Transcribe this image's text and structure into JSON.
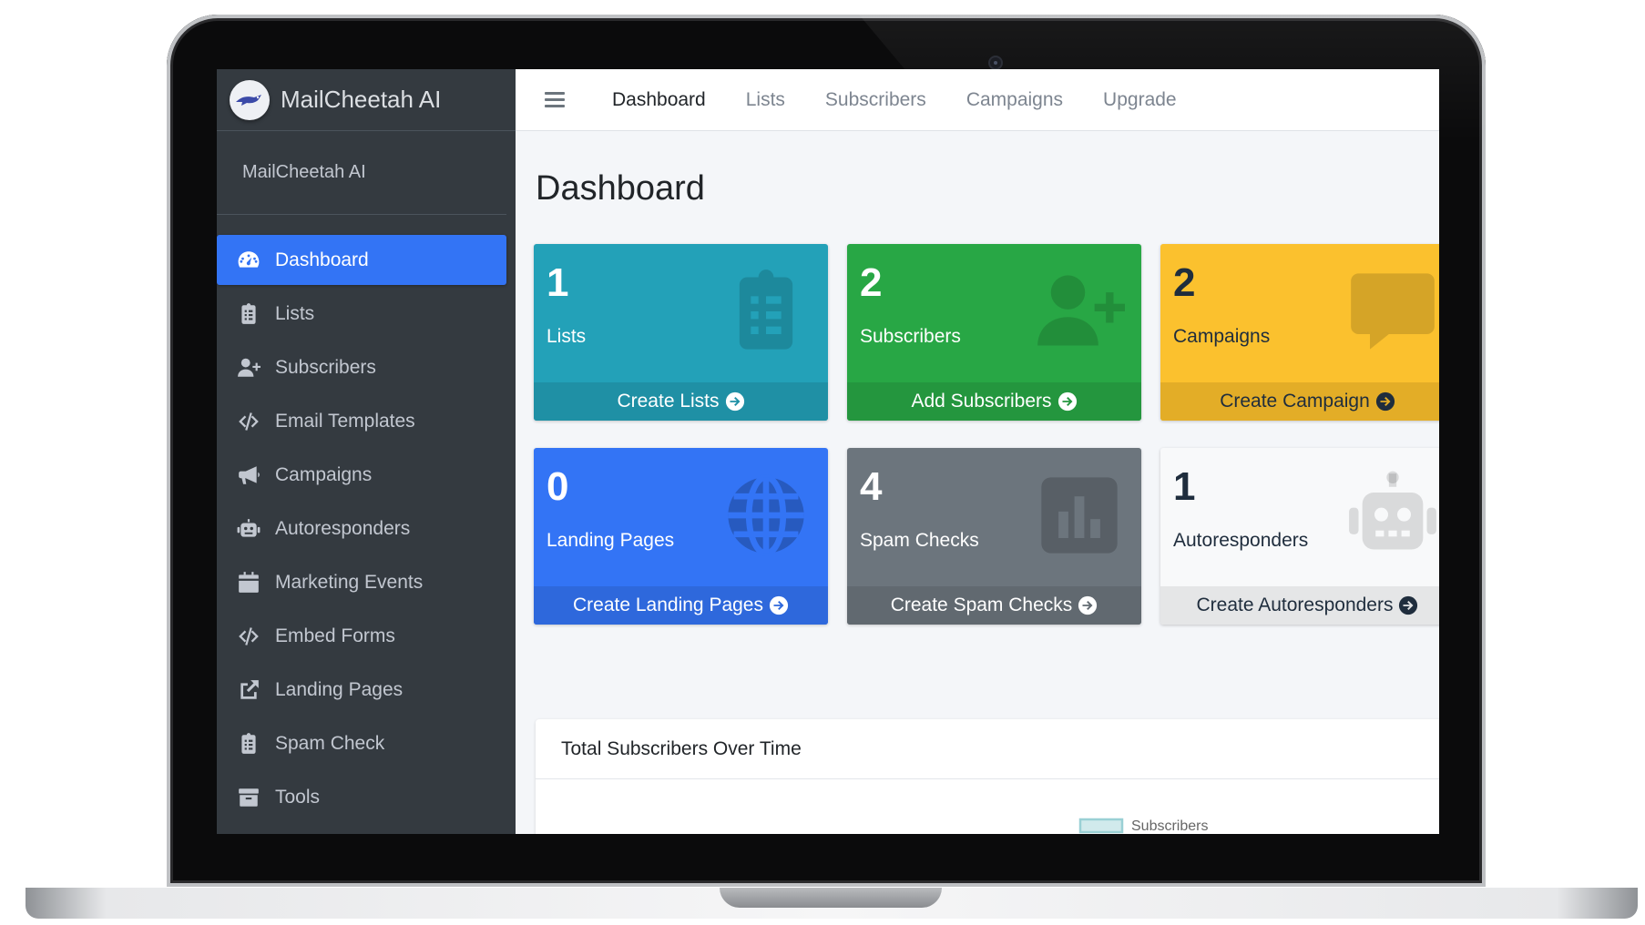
{
  "brand": {
    "name": "MailCheetah AI"
  },
  "user_panel": {
    "name": "MailCheetah AI"
  },
  "sidebar": {
    "items": [
      {
        "label": "Dashboard",
        "icon": "tachometer-icon",
        "active": true
      },
      {
        "label": "Lists",
        "icon": "clipboard-list-icon"
      },
      {
        "label": "Subscribers",
        "icon": "user-plus-icon"
      },
      {
        "label": "Email Templates",
        "icon": "code-icon"
      },
      {
        "label": "Campaigns",
        "icon": "bullhorn-icon"
      },
      {
        "label": "Autoresponders",
        "icon": "robot-icon"
      },
      {
        "label": "Marketing Events",
        "icon": "calendar-icon"
      },
      {
        "label": "Embed Forms",
        "icon": "code-icon"
      },
      {
        "label": "Landing Pages",
        "icon": "external-link-icon"
      },
      {
        "label": "Spam Check",
        "icon": "clipboard-list-icon"
      },
      {
        "label": "Tools",
        "icon": "archive-icon"
      }
    ]
  },
  "topnav": {
    "links": [
      "Dashboard",
      "Lists",
      "Subscribers",
      "Campaigns",
      "Upgrade"
    ]
  },
  "main": {
    "title": "Dashboard",
    "boxes": [
      {
        "count": "1",
        "label": "Lists",
        "footer": "Create Lists",
        "color": "#23a1b8",
        "icon": "clipboard-list-icon"
      },
      {
        "count": "2",
        "label": "Subscribers",
        "footer": "Add Subscribers",
        "color": "#28a745",
        "icon": "user-plus-icon"
      },
      {
        "count": "2",
        "label": "Campaigns",
        "footer": "Create Campaign",
        "color": "#fbc12e",
        "icon": "comment-icon"
      },
      {
        "count": "0",
        "label": "Landing Pages",
        "footer": "Create Landing Pages",
        "color": "#3374f5",
        "icon": "globe-icon"
      },
      {
        "count": "4",
        "label": "Spam Checks",
        "footer": "Create Spam Checks",
        "color": "#6c757d",
        "icon": "chart-bar-icon"
      },
      {
        "count": "1",
        "label": "Autoresponders",
        "footer": "Create Autoresponders",
        "color": "#f8f9fa",
        "icon": "robot-icon"
      }
    ],
    "chart_card": {
      "title": "Total Subscribers Over Time"
    }
  },
  "chart_data": {
    "type": "line",
    "title": "",
    "series": [
      {
        "name": "Subscribers",
        "values": []
      }
    ],
    "ylabel": "",
    "xlabel": "",
    "yticks": [
      "3.0",
      "2.8"
    ],
    "ylim": [
      2.8,
      3.0
    ],
    "legend": "top-center",
    "series_color": "#9ad0d5"
  }
}
